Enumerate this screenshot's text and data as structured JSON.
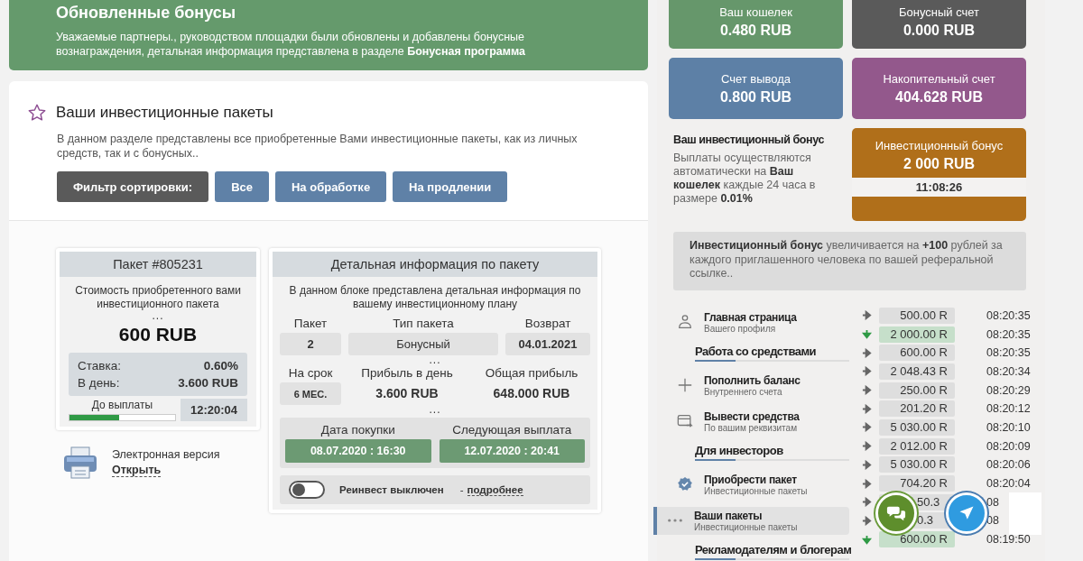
{
  "banner": {
    "title": "Обновленные бонусы",
    "text": "Уважаемые партнеры., руководством площадки были обновлены и добавлены бонусные вознаграждения, детальная информация представлена в разделе **Бонусная программа**"
  },
  "packages_section": {
    "title": "Ваши инвестиционные пакеты",
    "description": "В данном разделе представлены все приобретенные Вами инвестиционные пакеты, как из личных средств, так и с бонусных..",
    "filters": [
      {
        "kind": "label",
        "label": "Фильтр сортировки:"
      },
      {
        "kind": "option",
        "label": "Все"
      },
      {
        "kind": "option",
        "label": "На обработке"
      },
      {
        "kind": "option",
        "label": "На продлении"
      }
    ]
  },
  "package": {
    "title": "Пакет #805231",
    "cost_label": "Стоимость приобретенного вами инвестиционного пакета",
    "separator": "...",
    "price": "600 RUB",
    "rate_label": "Ставка:",
    "rate": "0.60%",
    "daily_label": "В день:",
    "daily": "3.600 RUB",
    "payout_label": "До выплаты",
    "level": 0.47,
    "timer": "12:20:04"
  },
  "electronic": {
    "label": "Электронная версия",
    "link": "Открыть"
  },
  "details": {
    "title": "Детальная информация по пакету",
    "description": "В данном блоке представлена детальная информация по вашему инвестиционному плану",
    "fields_top": [
      {
        "label": "Пакет",
        "value": "2"
      },
      {
        "label": "Тип пакета",
        "value": "Бонусный"
      },
      {
        "label": "Возврат",
        "value": "04.01.2021"
      }
    ],
    "separator_1": "...",
    "fields_bottom": [
      {
        "kind": "box",
        "label": "На срок",
        "value": "6 МЕС."
      },
      {
        "kind": "plain",
        "label": "Прибыль в день",
        "value": "3.600 RUB"
      },
      {
        "kind": "plain",
        "label": "Общая прибыль",
        "value": "648.000 RUB"
      }
    ],
    "separator_2": "...",
    "dates": [
      {
        "label": "Дата покупки",
        "value": "08.07.2020 : 16:30"
      },
      {
        "label": "Следующая выплата",
        "value": "12.07.2020 : 20:41"
      }
    ],
    "reinvest": {
      "on": false,
      "label": "Реинвест выключен",
      "dash": "-",
      "link": "подробнее"
    }
  },
  "accounts": [
    {
      "title": "Ваш кошелек",
      "amount": "0.480 RUB",
      "color": "#66976b"
    },
    {
      "title": "Бонусный счет",
      "amount": "0.000 RUB",
      "color": "#5a5a5a"
    },
    {
      "title": "Счет вывода",
      "amount": "0.800 RUB",
      "color": "#5d80a6"
    },
    {
      "title": "Накопительный счет",
      "amount": "404.628 RUB",
      "color": "#93588c"
    }
  ],
  "investment_bonus": {
    "title": "Ваш инвестиционный бонус",
    "text": "Выплаты осуществляются автоматически на **Ваш кошелек** каждые 24 часа в размере **0.01%**",
    "card_title": "Инвестиционный бонус",
    "amount": "2 000 RUB",
    "timer": "11:08:26"
  },
  "referral_note": "**Инвестиционный бонус** увеличивается на **+100** рублей за каждого приглашенного человека по вашей реферальной ссылке..",
  "sidebar": {
    "items": [
      {
        "kind": "link",
        "title": "Главная страница",
        "subtitle": "Вашего профиля",
        "selected": false
      },
      {
        "kind": "heading",
        "title": "Работа со средствами"
      },
      {
        "kind": "link",
        "title": "Пополнить баланс",
        "subtitle": "Внутреннего счета",
        "selected": false
      },
      {
        "kind": "link",
        "title": "Вывести средства",
        "subtitle": "По вашим реквизитам",
        "selected": false
      },
      {
        "kind": "heading",
        "title": "Для инвесторов"
      },
      {
        "kind": "link",
        "title": "Приобрести пакет",
        "subtitle": "Инвестиционные пакеты",
        "selected": false
      },
      {
        "kind": "link",
        "title": "Ваши пакеты",
        "subtitle": "Инвестиционные пакеты",
        "selected": true
      },
      {
        "kind": "heading",
        "title": "Рекламодателям и блогерам"
      }
    ]
  },
  "transactions": [
    {
      "kind": "out",
      "amount": "500.00 R",
      "time": "08:20:35"
    },
    {
      "kind": "in",
      "amount": "2 000.00 R",
      "time": "08:20:35"
    },
    {
      "kind": "out",
      "amount": "600.00 R",
      "time": "08:20:35"
    },
    {
      "kind": "out",
      "amount": "2 048.43 R",
      "time": "08:20:34"
    },
    {
      "kind": "out",
      "amount": "250.00 R",
      "time": "08:20:29"
    },
    {
      "kind": "out",
      "amount": "201.20 R",
      "time": "08:20:12"
    },
    {
      "kind": "out",
      "amount": "5 030.00 R",
      "time": "08:20:10"
    },
    {
      "kind": "out",
      "amount": "2 012.00 R",
      "time": "08:20:09"
    },
    {
      "kind": "out",
      "amount": "5 030.00 R",
      "time": "08:20:06"
    },
    {
      "kind": "out",
      "amount": "704.20 R",
      "time": "08:20:04"
    },
    {
      "kind": "covered",
      "amount": "50.3",
      "time": "08"
    },
    {
      "kind": "covered",
      "amount": "0.3",
      "time": "08"
    },
    {
      "kind": "in",
      "amount": "600.00 R",
      "time": "08:19:50"
    }
  ]
}
